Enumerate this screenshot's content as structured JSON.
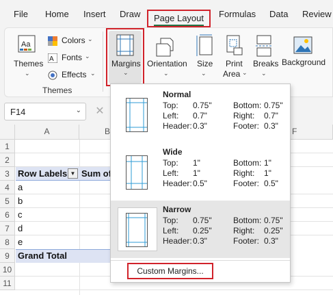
{
  "tabs": [
    "File",
    "Home",
    "Insert",
    "Draw",
    "Page Layout",
    "Formulas",
    "Data",
    "Review"
  ],
  "ribbon": {
    "themes": "Themes",
    "colors": "Colors",
    "fonts": "Fonts",
    "effects": "Effects",
    "themes_group": "Themes",
    "margins": "Margins",
    "orientation": "Orientation",
    "size": "Size",
    "print_area_1": "Print",
    "print_area_2": "Area",
    "breaks": "Breaks",
    "background": "Background"
  },
  "name_box": "F14",
  "grid": {
    "col_a": "A",
    "col_b": "B",
    "col_f": "F",
    "rows": [
      "1",
      "2",
      "3",
      "4",
      "5",
      "6",
      "7",
      "8",
      "9",
      "10",
      "11"
    ],
    "row_labels": "Row Labels",
    "sum_of": "Sum of",
    "items": [
      "a",
      "b",
      "c",
      "d",
      "e"
    ],
    "grand_total": "Grand Total"
  },
  "margins_menu": {
    "options": [
      {
        "name": "Normal",
        "top_label": "Top:",
        "top": "0.75\"",
        "bottom_label": "Bottom:",
        "bottom": "0.75\"",
        "left_label": "Left:",
        "left": "0.7\"",
        "right_label": "Right:",
        "right": "0.7\"",
        "header_label": "Header:",
        "header": "0.3\"",
        "footer_label": "Footer:",
        "footer": "0.3\""
      },
      {
        "name": "Wide",
        "top_label": "Top:",
        "top": "1\"",
        "bottom_label": "Bottom:",
        "bottom": "1\"",
        "left_label": "Left:",
        "left": "1\"",
        "right_label": "Right:",
        "right": "1\"",
        "header_label": "Header:",
        "header": "0.5\"",
        "footer_label": "Footer:",
        "footer": "0.5\""
      },
      {
        "name": "Narrow",
        "top_label": "Top:",
        "top": "0.75\"",
        "bottom_label": "Bottom:",
        "bottom": "0.75\"",
        "left_label": "Left:",
        "left": "0.25\"",
        "right_label": "Right:",
        "right": "0.25\"",
        "header_label": "Header:",
        "header": "0.3\"",
        "footer_label": "Footer:",
        "footer": "0.3\""
      }
    ],
    "custom": "Custom Margins..."
  },
  "colors": {
    "highlight": "#d1222a",
    "accent": "#217346",
    "table_header": "#dde3f3"
  }
}
